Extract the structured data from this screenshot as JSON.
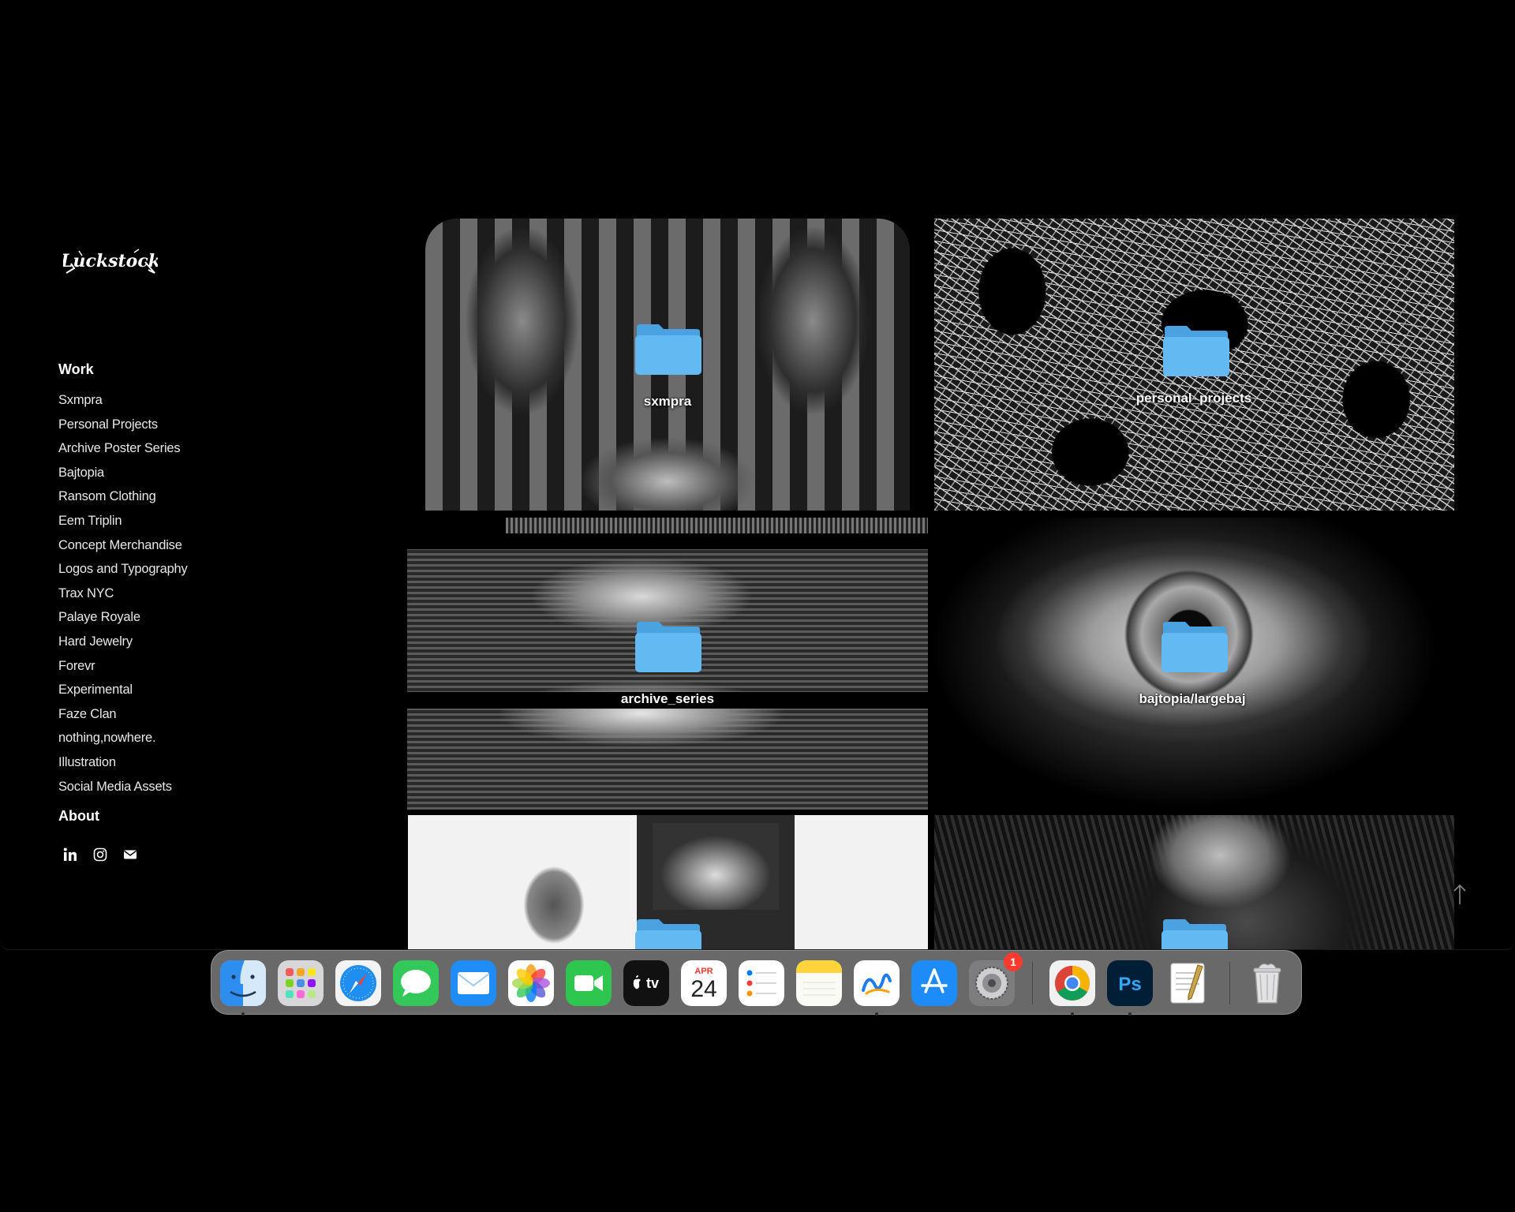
{
  "site": {
    "logo_text": "Luckstock",
    "nav": {
      "work_heading": "Work",
      "items": [
        "Sxmpra",
        "Personal Projects",
        "Archive Poster Series",
        "Bajtopia",
        "Ransom Clothing",
        "Eem Triplin",
        "Concept Merchandise",
        "Logos and Typography",
        "Trax NYC",
        "Palaye Royale",
        "Hard Jewelry",
        "Forevr",
        "Experimental",
        "Faze Clan",
        "nothing,nowhere.",
        "Illustration",
        "Social Media Assets"
      ],
      "about_heading": "About"
    },
    "social": [
      "linkedin-icon",
      "instagram-icon",
      "mail-icon"
    ],
    "tiles": [
      {
        "label": "sxmpra"
      },
      {
        "label": "personal_projects"
      },
      {
        "label": "archive_series"
      },
      {
        "label": "bajtopia/largebaj"
      },
      {
        "label": ""
      },
      {
        "label": ""
      }
    ]
  },
  "dock": {
    "apps": [
      {
        "name": "Finder",
        "icon": "finder-icon",
        "running": true
      },
      {
        "name": "Launchpad",
        "icon": "launchpad-icon",
        "running": false
      },
      {
        "name": "Safari",
        "icon": "safari-icon",
        "running": false
      },
      {
        "name": "Messages",
        "icon": "messages-icon",
        "running": false
      },
      {
        "name": "Mail",
        "icon": "mail-app-icon",
        "running": false
      },
      {
        "name": "Photos",
        "icon": "photos-icon",
        "running": false
      },
      {
        "name": "FaceTime",
        "icon": "facetime-icon",
        "running": false
      },
      {
        "name": "TV",
        "icon": "apple-tv-icon",
        "running": false
      },
      {
        "name": "Calendar",
        "icon": "calendar-icon",
        "running": false
      },
      {
        "name": "Reminders",
        "icon": "reminders-icon",
        "running": false
      },
      {
        "name": "Notes",
        "icon": "notes-icon",
        "running": false
      },
      {
        "name": "Freeform",
        "icon": "freeform-icon",
        "running": true
      },
      {
        "name": "App Store",
        "icon": "app-store-icon",
        "running": false
      },
      {
        "name": "System Settings",
        "icon": "system-settings-icon",
        "running": false
      },
      {
        "name": "Chrome",
        "icon": "chrome-icon",
        "running": true
      },
      {
        "name": "Photoshop",
        "icon": "photoshop-icon",
        "running": true
      },
      {
        "name": "TextEdit",
        "icon": "textedit-icon",
        "running": false
      },
      {
        "name": "Trash",
        "icon": "trash-icon",
        "running": false
      }
    ],
    "tv_label": "tv",
    "calendar_month": "APR",
    "calendar_day": "24",
    "photoshop_label": "Ps",
    "settings_badge": "1"
  },
  "colors": {
    "background": "#000000",
    "folder_blue": "#5fb6f0",
    "badge_red": "#ff3b30"
  }
}
